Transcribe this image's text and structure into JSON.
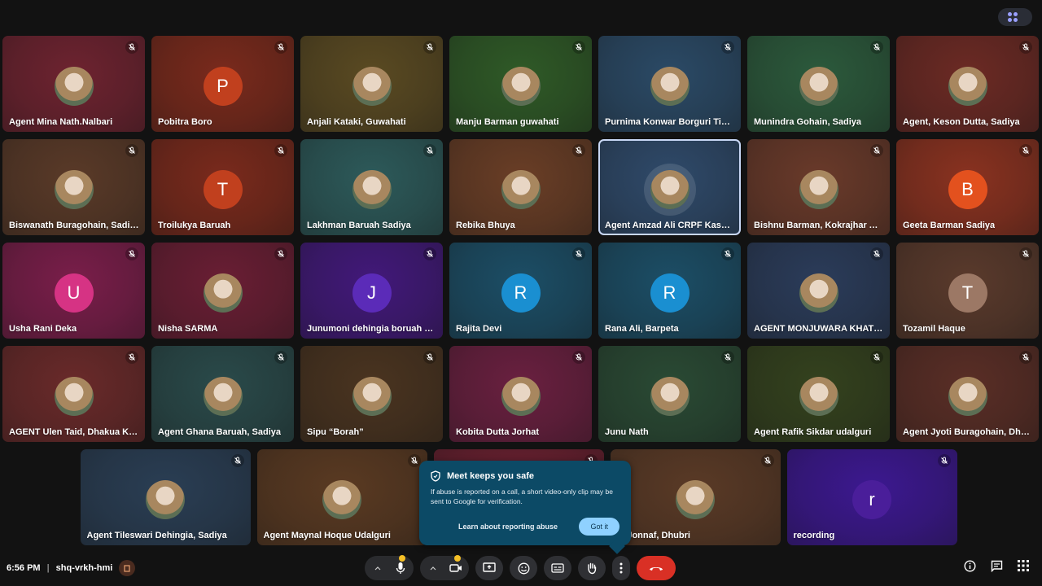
{
  "participants": [
    {
      "name": "Agent Mina Nath.Nalbari",
      "avatar": "photo",
      "bg": "#6e2330",
      "mic": "muted"
    },
    {
      "name": "Pobitra Boro",
      "avatar": "P",
      "avatarColor": "#c1401e",
      "bg": "#7a2a1c",
      "mic": "muted"
    },
    {
      "name": "Anjali Kataki, Guwahati",
      "avatar": "photo",
      "bg": "#5a4a22",
      "mic": "muted"
    },
    {
      "name": "Manju Barman guwahati",
      "avatar": "photo",
      "bg": "#2f5a27",
      "mic": "muted"
    },
    {
      "name": "Purnima Konwar Borguri Tins…",
      "avatar": "photo",
      "bg": "#2b4a66",
      "mic": "muted"
    },
    {
      "name": "Munindra Gohain, Sadiya",
      "avatar": "photo",
      "bg": "#2c5a3c",
      "mic": "muted"
    },
    {
      "name": "Agent, Keson Dutta, Sadiya",
      "avatar": "photo",
      "bg": "#6c2a24",
      "mic": "muted"
    },
    {
      "name": "Biswanath Buragohain, Sadiya",
      "avatar": "photo",
      "bg": "#5a3a28",
      "mic": "muted"
    },
    {
      "name": "Troilukya Baruah",
      "avatar": "T",
      "avatarColor": "#c1401e",
      "bg": "#7a2a1c",
      "mic": "muted"
    },
    {
      "name": "Lakhman Baruah Sadiya",
      "avatar": "photo",
      "bg": "#2d5a5a",
      "mic": "muted"
    },
    {
      "name": "Rebika Bhuya",
      "avatar": "photo",
      "bg": "#6a3e26",
      "mic": "muted"
    },
    {
      "name": "Agent Amzad Ali CRPF Kash…",
      "avatar": "photo",
      "bg": "#2f4a6a",
      "mic": "none",
      "active": true
    },
    {
      "name": "Bishnu Barman, Kokrajhar As…",
      "avatar": "photo",
      "bg": "#6a3a2a",
      "mic": "muted"
    },
    {
      "name": "Geeta Barman Sadiya",
      "avatar": "B",
      "avatarColor": "#e3511e",
      "bg": "#8a3220",
      "mic": "muted"
    },
    {
      "name": "Usha Rani Deka",
      "avatar": "U",
      "avatarColor": "#d63384",
      "bg": "#7a1e4a",
      "mic": "muted"
    },
    {
      "name": "Nisha SARMA",
      "avatar": "photo",
      "bg": "#6a1e34",
      "mic": "muted"
    },
    {
      "name": "Junumoni dehingia boruah J…",
      "avatar": "J",
      "avatarColor": "#5b2bb8",
      "bg": "#42197a",
      "mic": "muted"
    },
    {
      "name": "Rajita Devi",
      "avatar": "R",
      "avatarColor": "#1a8fd1",
      "bg": "#1c4e66",
      "mic": "muted"
    },
    {
      "name": "Rana Ali, Barpeta",
      "avatar": "R",
      "avatarColor": "#1a8fd1",
      "bg": "#1c4e66",
      "mic": "muted"
    },
    {
      "name": "AGENT MONJUWARA KHAT…",
      "avatar": "photo",
      "bg": "#2b3c5a",
      "mic": "muted"
    },
    {
      "name": "Tozamil Haque",
      "avatar": "T",
      "avatarColor": "#9c7865",
      "bg": "#5a3a2c",
      "mic": "muted"
    },
    {
      "name": "AGENT Ulen Taid, Dhakua Kh…",
      "avatar": "photo",
      "bg": "#6a2a2a",
      "mic": "muted"
    },
    {
      "name": "Agent Ghana Baruah, Sadiya",
      "avatar": "photo",
      "bg": "#2a4a4a",
      "mic": "muted"
    },
    {
      "name": "Sipu “Borah”",
      "avatar": "photo",
      "bg": "#4a3420",
      "mic": "muted"
    },
    {
      "name": "Kobita Dutta Jorhat",
      "avatar": "photo",
      "bg": "#6a2040",
      "mic": "muted"
    },
    {
      "name": "Junu Nath",
      "avatar": "photo",
      "bg": "#2a4a34",
      "mic": "muted"
    },
    {
      "name": "Agent Rafik Sikdar udalguri",
      "avatar": "photo",
      "bg": "#34421e",
      "mic": "muted"
    },
    {
      "name": "Agent Jyoti Buragohain, Dhe…",
      "avatar": "photo",
      "bg": "#5a2e26",
      "mic": "muted"
    }
  ],
  "last_row": [
    {
      "name": "Agent Tileswari Dehingia, Sadiya",
      "avatar": "photo",
      "bg": "#2a3e54",
      "mic": "muted"
    },
    {
      "name": "Agent Maynal Hoque Udalguri",
      "avatar": "photo",
      "bg": "#5a3a22",
      "mic": "muted"
    },
    {
      "name": "",
      "avatar": "none",
      "bg": "#6a2030",
      "mic": "muted"
    },
    {
      "name": "ul Jonnaf, Dhubri",
      "avatar": "photo",
      "bg": "#5a3a26",
      "mic": "muted"
    },
    {
      "name": "recording",
      "avatar": "r",
      "avatarColor": "#4a1e9a",
      "bg": "#3c1890",
      "mic": "muted"
    }
  ],
  "popup": {
    "title": "Meet keeps you safe",
    "body": "If abuse is reported on a call, a short video-only clip may be sent to Google for verification.",
    "link": "Learn about reporting abuse",
    "button": "Got it"
  },
  "meeting": {
    "time": "6:56 PM",
    "separator": "|",
    "code": "shq-vrkh-hmi"
  },
  "icons": {
    "mic": "mic-icon",
    "camera": "camera-icon",
    "present": "present-icon",
    "emoji": "emoji-icon",
    "captions": "captions-icon",
    "hand": "raise-hand-icon",
    "more": "more-vert-icon",
    "end": "end-call-icon",
    "info": "info-icon",
    "chat": "chat-icon",
    "activities": "activities-icon"
  },
  "colors": {
    "end_call": "#d93025",
    "popup_bg": "#0c4a66",
    "warning": "#f6c026"
  }
}
